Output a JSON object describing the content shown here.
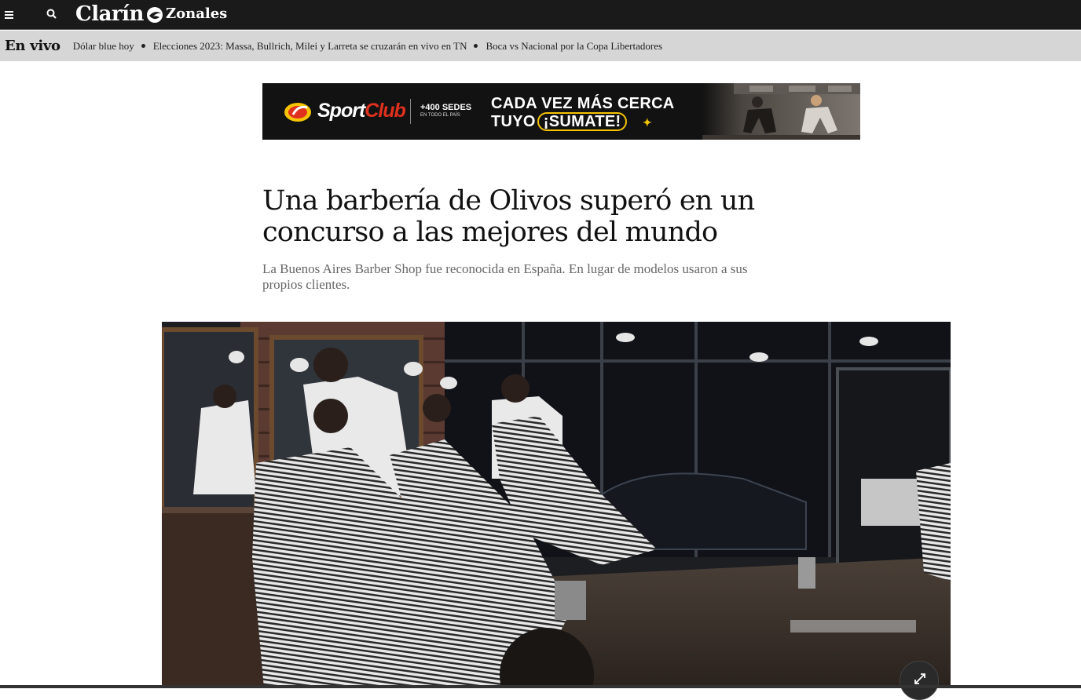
{
  "header": {
    "menu_icon": "hamburger-icon",
    "search_icon": "search-icon",
    "logo_text": "Clarín",
    "section_label": "Zonales",
    "bg_color": "#1a1a1a"
  },
  "live_bar": {
    "label": "En vivo",
    "links": [
      "Dólar blue hoy",
      "Elecciones 2023: Massa, Bullrich, Milei y Larreta se cruzarán en vivo en TN",
      "Boca vs Nacional por la Copa Libertadores"
    ],
    "bg_color": "#d6d6d6"
  },
  "ad": {
    "brand_sport": "Sport",
    "brand_club": "Club",
    "sedes": "+400 SEDES",
    "sedes_sub": "EN TODO EL PAÍS",
    "line1": "CADA VEZ MÁS CERCA",
    "line2_prefix": "TUYO",
    "cta": "¡SUMATE!",
    "accent_color": "#f5c400"
  },
  "article": {
    "headline": "Una barbería de Olivos superó en un concurso a las mejores del mundo",
    "subhead": "La Buenos Aires Barber Shop fue reconocida en España. En lugar de modelos usaron a sus propios clientes.",
    "expand_icon": "expand-icon"
  }
}
